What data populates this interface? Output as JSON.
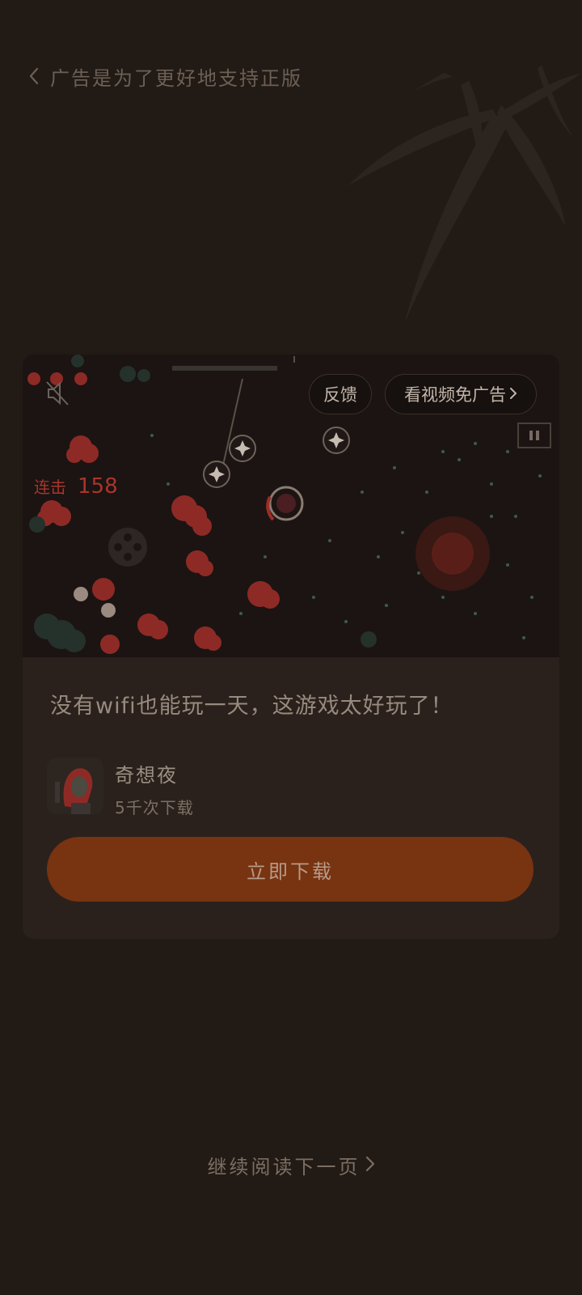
{
  "header": {
    "title": "广告是为了更好地支持正版",
    "back_icon": "chevron-left-icon"
  },
  "ad": {
    "feedback_label": "反馈",
    "remove_ads_label": "看视频免广告",
    "combo_label": "连击",
    "combo_value": "158",
    "headline": "没有wifi也能玩一天，这游戏太好玩了！",
    "app_name": "奇想夜",
    "app_downloads": "5千次下载",
    "download_label": "立即下载",
    "icons": [
      "mute-icon",
      "pause-icon",
      "chevron-right-icon"
    ]
  },
  "footer": {
    "continue_label": "继续阅读下一页"
  },
  "colors": {
    "background": "#221a15",
    "card": "#2a211c",
    "accent": "#783311",
    "combo_red": "#a8352c"
  }
}
